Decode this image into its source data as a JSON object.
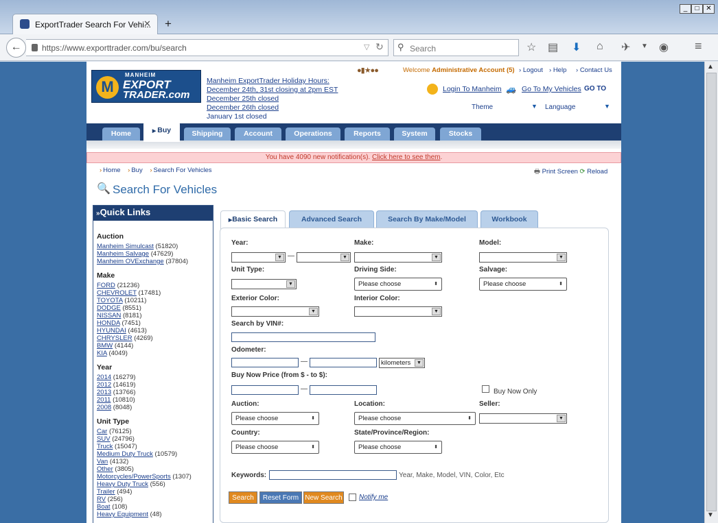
{
  "browser": {
    "tab_title": "ExportTrader Search For Vehi...",
    "url": "https://www.exporttrader.com/bu/search",
    "search_placeholder": "Search"
  },
  "header": {
    "logo_top": "MANHEIM",
    "logo_mid": "EXPORT",
    "logo_bottom": "TRADER.com",
    "holiday": [
      "Manheim ExportTrader Holiday Hours:",
      "December 24th, 31st closing at 2pm EST",
      "December 25th closed",
      "December 26th closed",
      "January 1st closed"
    ],
    "welcome_prefix": "Welcome",
    "welcome_name": "Administrative Account (5)",
    "logout": "Logout",
    "help": "Help",
    "contact": "Contact Us",
    "login_manheim": "Login To Manheim",
    "my_vehicles": "Go To My Vehicles",
    "goto": "GO TO",
    "theme": "Theme",
    "language": "Language"
  },
  "nav": {
    "tabs": [
      "Home",
      "Buy",
      "Shipping",
      "Account",
      "Operations",
      "Reports",
      "System",
      "Stocks"
    ]
  },
  "notification": {
    "text": "You have 4090 new notification(s).",
    "link": "Click here to see them",
    "period": "."
  },
  "breadcrumb": {
    "items": [
      "Home",
      "Buy",
      "Search For Vehicles"
    ],
    "print": "Print Screen",
    "reload": "Reload"
  },
  "page_title": "Search For Vehicles",
  "quick_links": {
    "title": "Quick Links",
    "sections": [
      {
        "title": "Auction",
        "items": [
          {
            "label": "Manheim Simulcast",
            "count": "(51820)"
          },
          {
            "label": "Manheim Salvage",
            "count": "(47629)"
          },
          {
            "label": "Manheim OVExchange",
            "count": "(37804)"
          }
        ]
      },
      {
        "title": "Make",
        "items": [
          {
            "label": "FORD",
            "count": "(21236)"
          },
          {
            "label": "CHEVROLET",
            "count": "(17481)"
          },
          {
            "label": "TOYOTA",
            "count": "(10211)"
          },
          {
            "label": "DODGE",
            "count": "(8551)"
          },
          {
            "label": "NISSAN",
            "count": "(8181)"
          },
          {
            "label": "HONDA",
            "count": "(7451)"
          },
          {
            "label": "HYUNDAI",
            "count": "(4613)"
          },
          {
            "label": "CHRYSLER",
            "count": "(4269)"
          },
          {
            "label": "BMW",
            "count": "(4144)"
          },
          {
            "label": "KIA",
            "count": "(4049)"
          }
        ]
      },
      {
        "title": "Year",
        "items": [
          {
            "label": "2014",
            "count": "(16279)"
          },
          {
            "label": "2012",
            "count": "(14619)"
          },
          {
            "label": "2013",
            "count": "(13766)"
          },
          {
            "label": "2011",
            "count": "(10810)"
          },
          {
            "label": "2008",
            "count": "(8048)"
          }
        ]
      },
      {
        "title": "Unit Type",
        "items": [
          {
            "label": "Car",
            "count": "(76125)"
          },
          {
            "label": "SUV",
            "count": "(24796)"
          },
          {
            "label": "Truck",
            "count": "(15047)"
          },
          {
            "label": "Medium Duty Truck",
            "count": "(10579)"
          },
          {
            "label": "Van",
            "count": "(4132)"
          },
          {
            "label": "Other",
            "count": "(3805)"
          },
          {
            "label": "Motorcycles/PowerSports",
            "count": "(1307)"
          },
          {
            "label": "Heavy Duty Truck",
            "count": "(556)"
          },
          {
            "label": "Trailer",
            "count": "(494)"
          },
          {
            "label": "RV",
            "count": "(256)"
          },
          {
            "label": "Boat",
            "count": "(108)"
          },
          {
            "label": "Heavy Equipment",
            "count": "(48)"
          }
        ]
      }
    ]
  },
  "search_tabs": [
    "Basic Search",
    "Advanced Search",
    "Search By Make/Model",
    "Workbook"
  ],
  "form": {
    "year": "Year:",
    "make": "Make:",
    "model": "Model:",
    "unit_type": "Unit Type:",
    "driving_side": "Driving Side:",
    "salvage": "Salvage:",
    "exterior_color": "Exterior Color:",
    "interior_color": "Interior Color:",
    "vin": "Search by VIN#:",
    "odometer": "Odometer:",
    "odometer_unit": "kilometers",
    "buy_now_price": "Buy Now Price (from $ - to $):",
    "buy_now_only": "Buy Now Only",
    "auction": "Auction:",
    "location": "Location:",
    "seller": "Seller:",
    "country": "Country:",
    "state": "State/Province/Region:",
    "please_choose": "Please choose",
    "keywords": "Keywords:",
    "keywords_hint": "Year, Make, Model, VIN, Color, Etc",
    "search_btn": "Search",
    "reset_btn": "Reset Form",
    "new_search_btn": "New Search",
    "notify": "Notify me"
  },
  "colors": {
    "page_blue": "#3a6ea5",
    "nav_dark": "#1e3f72",
    "nav_tab": "#7fa6d4",
    "accent_orange": "#e0891f",
    "reset_blue": "#4a78b4"
  }
}
